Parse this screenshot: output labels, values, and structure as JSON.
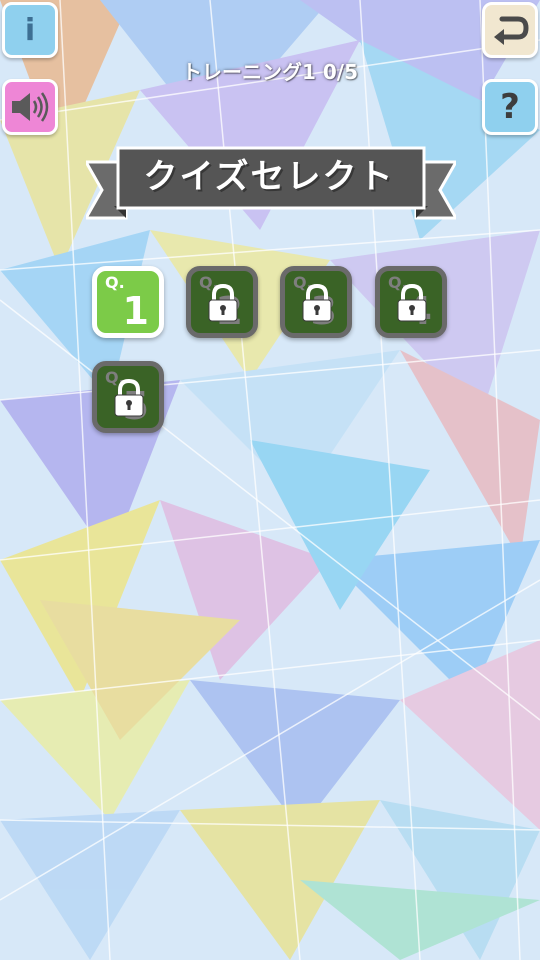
{
  "header": {
    "progress_text": "トレーニング1 0/5"
  },
  "buttons": {
    "info_icon": "i",
    "sound_icon": "speaker-icon",
    "back_icon": "return-arrow-icon",
    "help_icon": "?"
  },
  "banner": {
    "title": "クイズセレクト"
  },
  "quizzes": [
    {
      "label": "Q.",
      "number": "1",
      "state": "unlocked"
    },
    {
      "label": "Q.",
      "number": "2",
      "state": "locked"
    },
    {
      "label": "Q.",
      "number": "3",
      "state": "locked"
    },
    {
      "label": "Q.",
      "number": "4",
      "state": "locked"
    },
    {
      "label": "Q.",
      "number": "5",
      "state": "locked"
    }
  ],
  "colors": {
    "unlocked_tile": "#7ccb48",
    "locked_tile": "#3a6326",
    "banner": "#555555"
  }
}
